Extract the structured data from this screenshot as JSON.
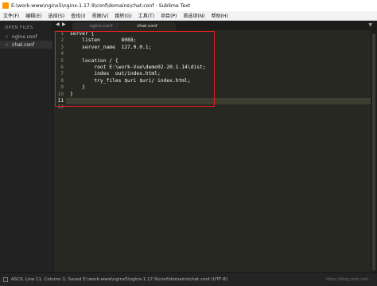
{
  "window": {
    "title": "E:\\work-www\\nginx5\\nginx-1.17.9\\conf\\domains\\chat.conf - Sublime Text"
  },
  "menubar": {
    "items": [
      "文件(F)",
      "编辑(E)",
      "选择(S)",
      "查找(I)",
      "视图(V)",
      "跳转(G)",
      "工具(T)",
      "项目(P)",
      "首选项(N)",
      "帮助(H)"
    ]
  },
  "sidebar": {
    "header": "OPEN FILES",
    "files": [
      {
        "name": "nginx.conf",
        "close": "×"
      },
      {
        "name": "chat.conf",
        "close": "×"
      }
    ]
  },
  "tabs": {
    "nav_left": "◀",
    "nav_right": "▶",
    "items": [
      "nginx.conf",
      "chat.conf"
    ],
    "dropdown": "▼"
  },
  "editor": {
    "line_numbers": [
      "1",
      "2",
      "3",
      "4",
      "5",
      "6",
      "7",
      "8",
      "9",
      "10",
      "11",
      "12"
    ],
    "lines": [
      "server {",
      "    listen       8088;",
      "    server_name  127.0.0.1;",
      "",
      "    location / {",
      "        root E:\\work-Vue\\demo02-20.1.14\\dist;",
      "        index  out/index.html;",
      "        try_files $uri $uri/ index.html;",
      "    }",
      "}",
      "",
      ""
    ],
    "current_line": 11
  },
  "statusbar": {
    "text": "ASCII, Line 11, Column 1; Saved E:\\work-www\\nginx5\\nginx-1.17.9\\conf\\domains\\chat.conf (UTF-8)",
    "watermark": "https://blog.csdn.net/..."
  }
}
